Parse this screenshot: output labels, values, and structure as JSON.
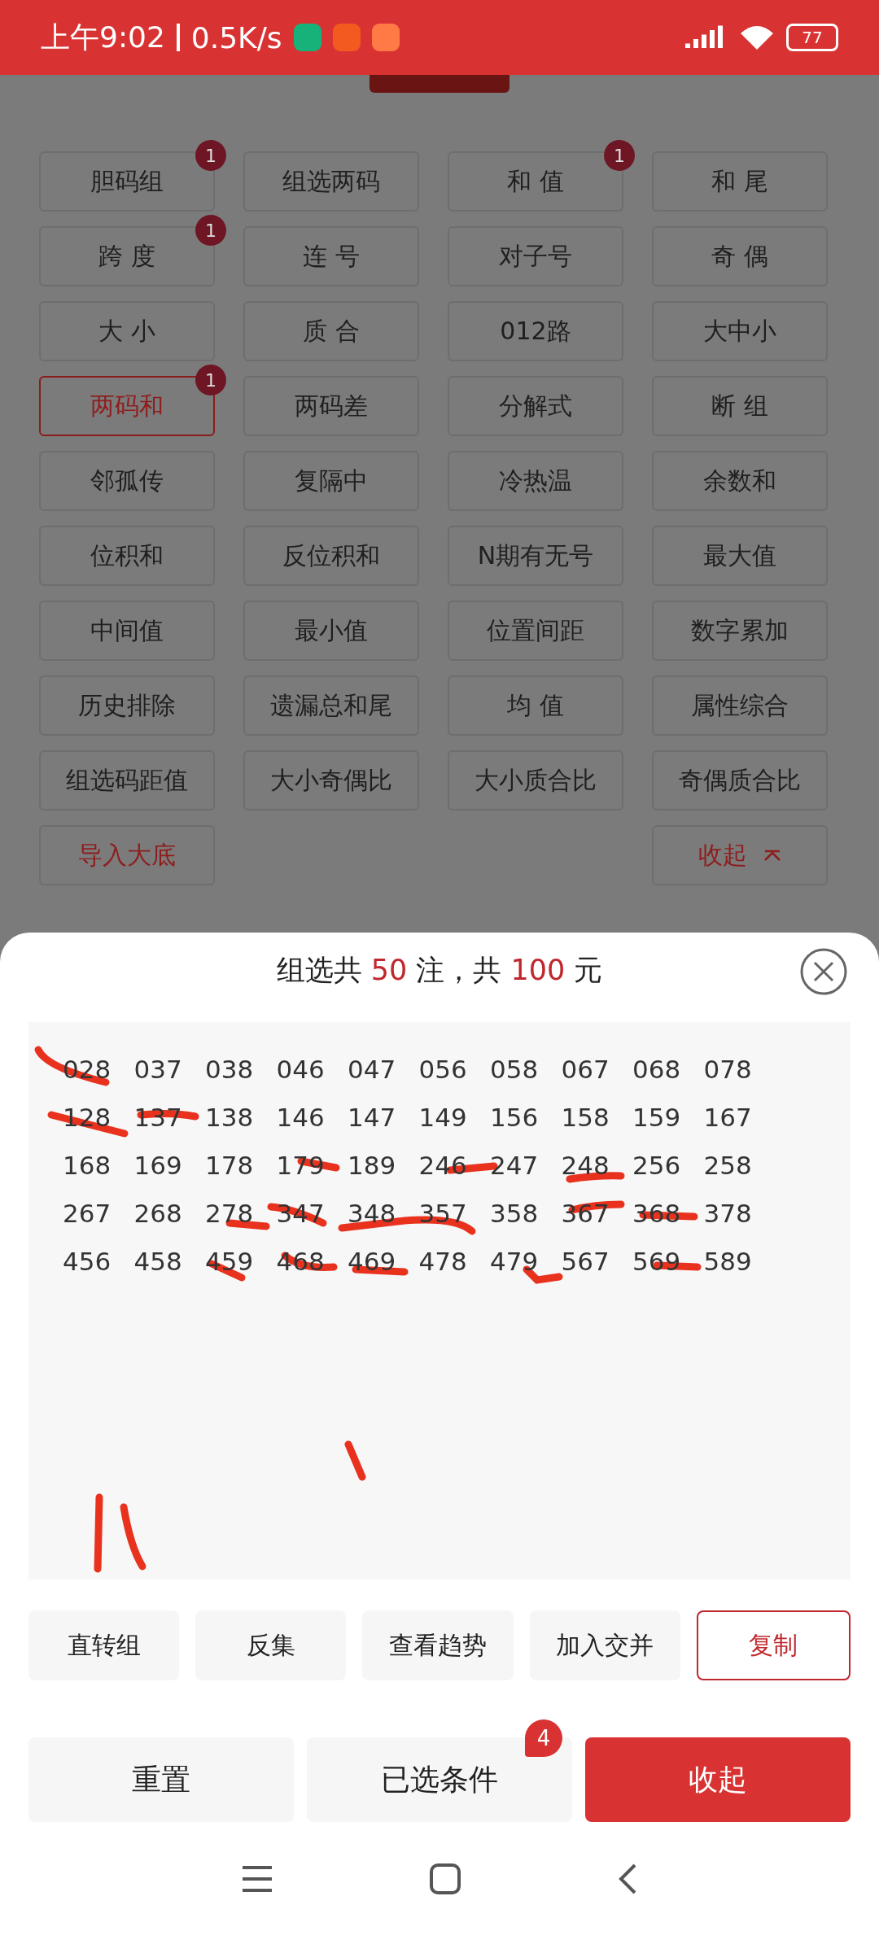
{
  "status_bar": {
    "time": "上午9:02",
    "speed": "0.5K/s",
    "battery": "77"
  },
  "filters": [
    {
      "label": "胆码组",
      "badge": "1",
      "selected": false,
      "kind": "filter"
    },
    {
      "label": "组选两码",
      "selected": false,
      "kind": "filter"
    },
    {
      "label": "和 值",
      "badge": "1",
      "selected": false,
      "kind": "filter"
    },
    {
      "label": "和 尾",
      "selected": false,
      "kind": "filter"
    },
    {
      "label": "跨 度",
      "badge": "1",
      "selected": false,
      "kind": "filter"
    },
    {
      "label": "连 号",
      "selected": false,
      "kind": "filter"
    },
    {
      "label": "对子号",
      "selected": false,
      "kind": "filter"
    },
    {
      "label": "奇 偶",
      "selected": false,
      "kind": "filter"
    },
    {
      "label": "大 小",
      "selected": false,
      "kind": "filter"
    },
    {
      "label": "质 合",
      "selected": false,
      "kind": "filter"
    },
    {
      "label": "012路",
      "selected": false,
      "kind": "filter"
    },
    {
      "label": "大中小",
      "selected": false,
      "kind": "filter"
    },
    {
      "label": "两码和",
      "badge": "1",
      "selected": true,
      "kind": "filter"
    },
    {
      "label": "两码差",
      "selected": false,
      "kind": "filter"
    },
    {
      "label": "分解式",
      "selected": false,
      "kind": "filter"
    },
    {
      "label": "断 组",
      "selected": false,
      "kind": "filter"
    },
    {
      "label": "邻孤传",
      "selected": false,
      "kind": "filter"
    },
    {
      "label": "复隔中",
      "selected": false,
      "kind": "filter"
    },
    {
      "label": "冷热温",
      "selected": false,
      "kind": "filter"
    },
    {
      "label": "余数和",
      "selected": false,
      "kind": "filter"
    },
    {
      "label": "位积和",
      "selected": false,
      "kind": "filter"
    },
    {
      "label": "反位积和",
      "selected": false,
      "kind": "filter"
    },
    {
      "label": "N期有无号",
      "selected": false,
      "kind": "filter"
    },
    {
      "label": "最大值",
      "selected": false,
      "kind": "filter"
    },
    {
      "label": "中间值",
      "selected": false,
      "kind": "filter"
    },
    {
      "label": "最小值",
      "selected": false,
      "kind": "filter"
    },
    {
      "label": "位置间距",
      "selected": false,
      "kind": "filter"
    },
    {
      "label": "数字累加",
      "selected": false,
      "kind": "filter"
    },
    {
      "label": "历史排除",
      "selected": false,
      "kind": "filter"
    },
    {
      "label": "遗漏总和尾",
      "selected": false,
      "kind": "filter"
    },
    {
      "label": "均 值",
      "selected": false,
      "kind": "filter"
    },
    {
      "label": "属性综合",
      "selected": false,
      "kind": "filter"
    },
    {
      "label": "组选码距值",
      "selected": false,
      "kind": "filter"
    },
    {
      "label": "大小奇偶比",
      "selected": false,
      "kind": "filter"
    },
    {
      "label": "大小质合比",
      "selected": false,
      "kind": "filter"
    },
    {
      "label": "奇偶质合比",
      "selected": false,
      "kind": "filter"
    },
    {
      "label": "导入大底",
      "selected": false,
      "kind": "link"
    },
    {
      "label": "收起",
      "selected": false,
      "kind": "collapse"
    }
  ],
  "sheet": {
    "title": {
      "prefix": "组选共",
      "count": "50",
      "middle": "注，共",
      "amount": "100",
      "suffix": "元"
    },
    "numbers": [
      "028",
      "037",
      "038",
      "046",
      "047",
      "056",
      "058",
      "067",
      "068",
      "078",
      "128",
      "137",
      "138",
      "146",
      "147",
      "149",
      "156",
      "158",
      "159",
      "167",
      "168",
      "169",
      "178",
      "179",
      "189",
      "246",
      "247",
      "248",
      "256",
      "258",
      "267",
      "268",
      "278",
      "347",
      "348",
      "357",
      "358",
      "367",
      "368",
      "378",
      "456",
      "458",
      "459",
      "468",
      "469",
      "478",
      "479",
      "567",
      "569",
      "589"
    ],
    "actions": [
      {
        "label": "直转组",
        "kind": "plain"
      },
      {
        "label": "反集",
        "kind": "plain"
      },
      {
        "label": "查看趋势",
        "kind": "plain"
      },
      {
        "label": "加入交并",
        "kind": "plain"
      },
      {
        "label": "复制",
        "kind": "outline"
      }
    ],
    "footer": [
      {
        "label": "重置",
        "kind": "secondary"
      },
      {
        "label": "已选条件",
        "kind": "secondary",
        "badge": "4"
      },
      {
        "label": "收起",
        "kind": "primary"
      }
    ]
  }
}
